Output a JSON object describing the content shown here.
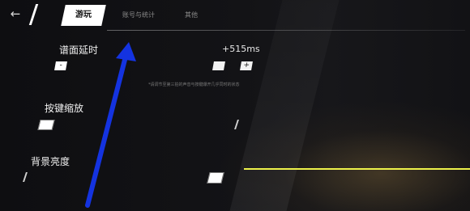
{
  "header": {
    "back_icon": "back-arrow-icon",
    "tabs": [
      {
        "label": "游玩",
        "active": true
      },
      {
        "label": "账号与统计",
        "active": false
      },
      {
        "label": "其他",
        "active": false
      }
    ]
  },
  "settings": {
    "offset": {
      "label": "谱面延时",
      "value": "+515ms",
      "minus_label": "-",
      "plus_label": "+",
      "hint": "*请调节至第三拍的声音与按键爆开几乎同时的状态"
    },
    "button_scale": {
      "label": "按键缩放"
    },
    "background_brightness": {
      "label": "背景亮度"
    }
  },
  "colors": {
    "accent_line": "#eef24a",
    "annotation_arrow": "#1433e0",
    "active_tab_bg": "#ffffff"
  }
}
